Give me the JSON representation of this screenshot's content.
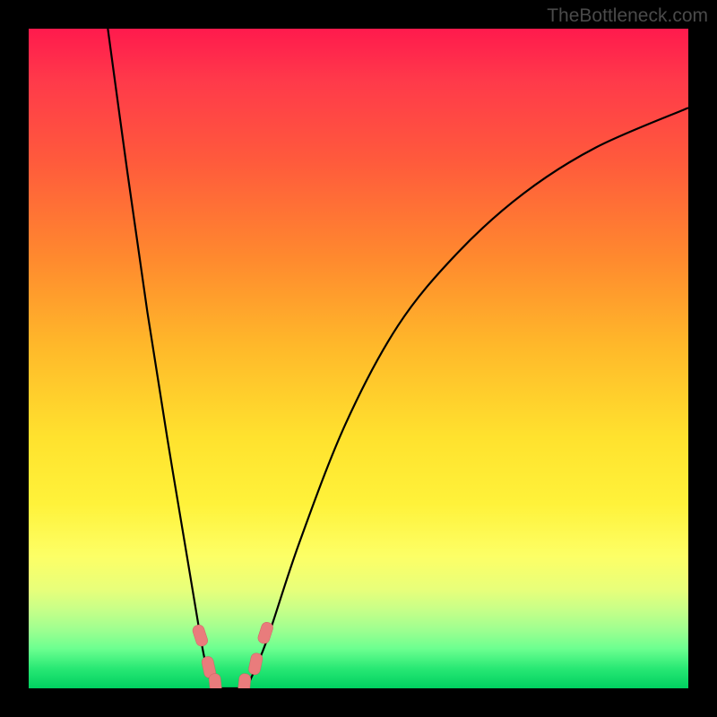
{
  "watermark": "TheBottleneck.com",
  "colors": {
    "frame": "#000000",
    "curve": "#000000",
    "marker": "#e97c7c",
    "marker_stroke": "#d06464"
  },
  "chart_data": {
    "type": "line",
    "title": "",
    "xlabel": "",
    "ylabel": "",
    "xlim": [
      0,
      100
    ],
    "ylim": [
      0,
      100
    ],
    "series": [
      {
        "name": "left-branch",
        "x": [
          12,
          15,
          18,
          21,
          24,
          26,
          27,
          28
        ],
        "y": [
          100,
          78,
          57,
          38,
          20,
          8,
          3,
          0
        ]
      },
      {
        "name": "flat-bottom",
        "x": [
          28,
          33
        ],
        "y": [
          0,
          0
        ]
      },
      {
        "name": "right-branch",
        "x": [
          33,
          36,
          41,
          48,
          56,
          65,
          75,
          86,
          100
        ],
        "y": [
          0,
          7,
          22,
          40,
          55,
          66,
          75,
          82,
          88
        ]
      }
    ],
    "markers": [
      {
        "x": 26.0,
        "y": 8.0
      },
      {
        "x": 27.3,
        "y": 3.2
      },
      {
        "x": 28.3,
        "y": 0.6
      },
      {
        "x": 32.7,
        "y": 0.6
      },
      {
        "x": 34.4,
        "y": 3.7
      },
      {
        "x": 35.9,
        "y": 8.4
      }
    ],
    "background_gradient": {
      "top": "#ff1a4d",
      "mid": "#ffe22e",
      "bottom": "#00d060"
    }
  }
}
